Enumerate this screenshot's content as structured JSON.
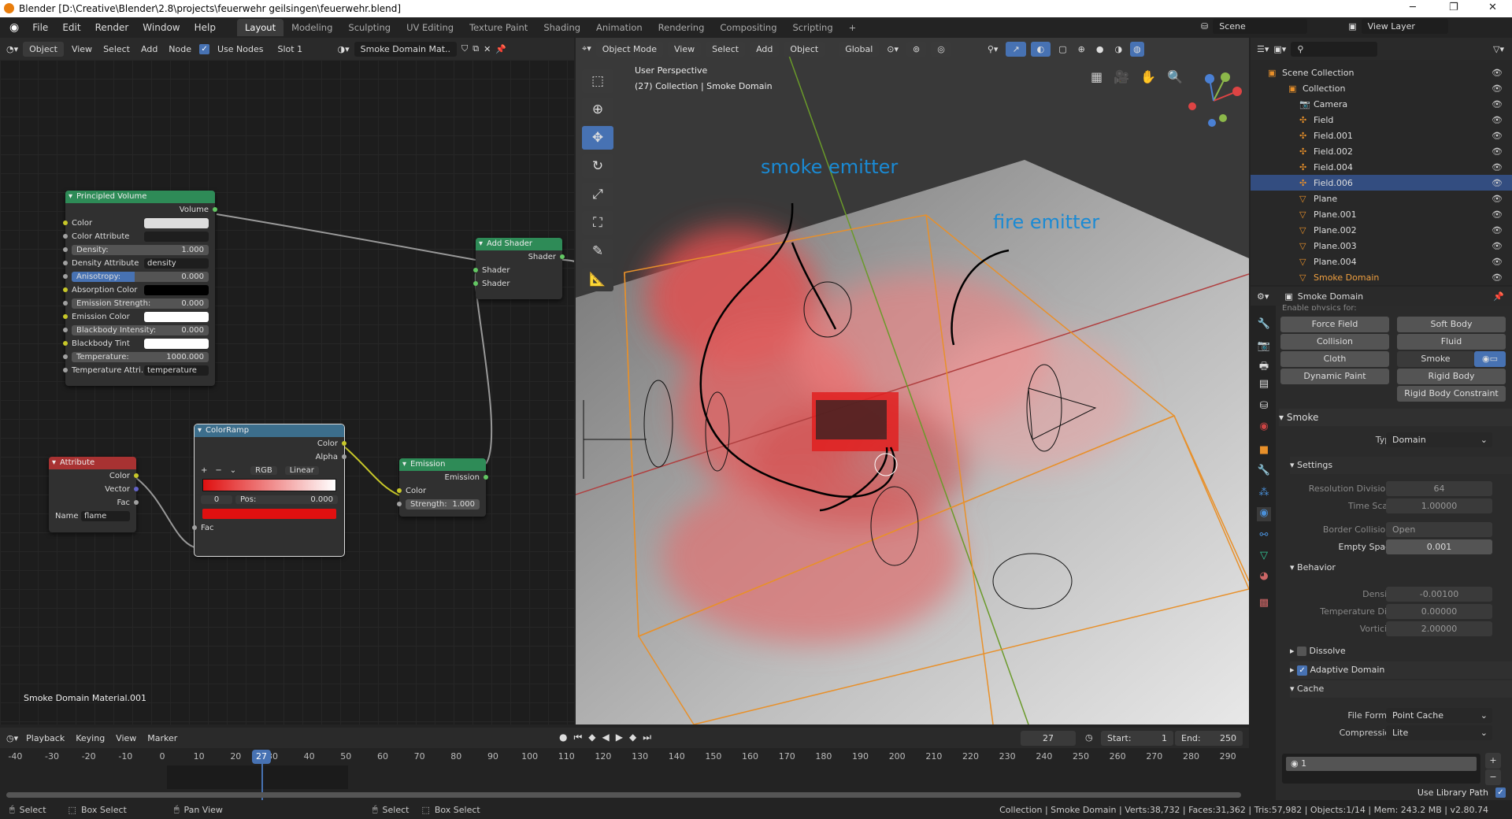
{
  "title": "Blender [D:\\Creative\\Blender\\2.8\\projects\\feuerwehr geilsingen\\feuerwehr.blend]",
  "menu": [
    "File",
    "Edit",
    "Render",
    "Window",
    "Help"
  ],
  "workspaces": [
    "Layout",
    "Modeling",
    "Sculpting",
    "UV Editing",
    "Texture Paint",
    "Shading",
    "Animation",
    "Rendering",
    "Compositing",
    "Scripting",
    "+"
  ],
  "active_workspace": "Layout",
  "scene": "Scene",
  "view_layer": "View Layer",
  "node_header": {
    "mode": "Object",
    "view": "View",
    "select": "Select",
    "add": "Add",
    "node": "Node",
    "use_nodes": "Use Nodes",
    "slot": "Slot 1",
    "material": "Smoke Domain Mat.."
  },
  "node_editor_label": "Smoke Domain Material.001",
  "nodes": {
    "principled": {
      "title": "Principled Volume",
      "output": "Volume",
      "color": "Color",
      "color_attr": "Color Attribute",
      "density_l": "Density:",
      "density_v": "1.000",
      "density_attr": "Density Attribute",
      "density_attr_v": "density",
      "aniso_l": "Anisotropy:",
      "aniso_v": "0.000",
      "absorption": "Absorption Color",
      "em_str_l": "Emission Strength:",
      "em_str_v": "0.000",
      "em_color": "Emission Color",
      "bb_int_l": "Blackbody Intensity:",
      "bb_int_v": "0.000",
      "bb_tint": "Blackbody Tint",
      "temp_l": "Temperature:",
      "temp_v": "1000.000",
      "temp_attr": "Temperature Attri..",
      "temp_attr_v": "temperature"
    },
    "add_shader": {
      "title": "Add Shader",
      "out": "Shader",
      "in1": "Shader",
      "in2": "Shader"
    },
    "colorramp": {
      "title": "ColorRamp",
      "color": "Color",
      "alpha": "Alpha",
      "mode": "RGB",
      "interp": "Linear",
      "index": "0",
      "pos_l": "Pos:",
      "pos_v": "0.000",
      "fac": "Fac",
      "stop_color": "#e01010"
    },
    "attribute": {
      "title": "Attribute",
      "color": "Color",
      "vector": "Vector",
      "fac": "Fac",
      "name_l": "Name",
      "name_v": "flame"
    },
    "emission": {
      "title": "Emission",
      "out": "Emission",
      "color": "Color",
      "str_l": "Strength:",
      "str_v": "1.000"
    }
  },
  "viewport_header": {
    "mode": "Object Mode",
    "view": "View",
    "select": "Select",
    "add": "Add",
    "object": "Object",
    "orientation": "Global"
  },
  "viewport": {
    "perspective": "User Perspective",
    "info": "(27) Collection | Smoke Domain",
    "label_smoke": "smoke emitter",
    "label_fire": "fire emitter"
  },
  "outliner": {
    "root": "Scene Collection",
    "items": [
      {
        "name": "Collection",
        "type": "collection"
      },
      {
        "name": "Camera",
        "type": "camera"
      },
      {
        "name": "Field",
        "type": "empty"
      },
      {
        "name": "Field.001",
        "type": "empty"
      },
      {
        "name": "Field.002",
        "type": "empty"
      },
      {
        "name": "Field.004",
        "type": "empty"
      },
      {
        "name": "Field.006",
        "type": "empty",
        "selected": true
      },
      {
        "name": "Plane",
        "type": "mesh"
      },
      {
        "name": "Plane.001",
        "type": "mesh"
      },
      {
        "name": "Plane.002",
        "type": "mesh"
      },
      {
        "name": "Plane.003",
        "type": "mesh"
      },
      {
        "name": "Plane.004",
        "type": "mesh"
      },
      {
        "name": "Smoke Domain",
        "type": "mesh",
        "active": true
      }
    ]
  },
  "properties": {
    "object": "Smoke Domain",
    "enable_physics": "Enable physics for:",
    "physics": [
      "Force Field",
      "Soft Body",
      "Collision",
      "Fluid",
      "Cloth",
      "Smoke",
      "Dynamic Paint",
      "Rigid Body",
      "Rigid Body Constraint"
    ],
    "smoke": "Smoke",
    "type_l": "Type",
    "type_v": "Domain",
    "settings": "Settings",
    "res_l": "Resolution Divisions",
    "res_v": "64",
    "ts_l": "Time Scale",
    "ts_v": "1.00000",
    "bc_l": "Border Collisions",
    "bc_v": "Open",
    "es_l": "Empty Space",
    "es_v": "0.001",
    "behavior": "Behavior",
    "den_l": "Density",
    "den_v": "-0.00100",
    "td_l": "Temperature Diff.",
    "td_v": "0.00000",
    "vor_l": "Vorticity",
    "vor_v": "2.00000",
    "dissolve": "Dissolve",
    "adaptive": "Adaptive Domain",
    "cache": "Cache",
    "ff_l": "File Format",
    "ff_v": "Point Cache",
    "comp_l": "Compression",
    "comp_v": "Lite",
    "cache_item": "1",
    "lib_path": "Use Library Path"
  },
  "timeline": {
    "playback": "Playback",
    "keying": "Keying",
    "view": "View",
    "marker": "Marker",
    "current": "27",
    "start_l": "Start:",
    "start": "1",
    "end_l": "End:",
    "end": "250",
    "ticks": [
      -40,
      -30,
      -20,
      -10,
      0,
      10,
      20,
      30,
      40,
      50,
      60,
      70,
      80,
      90,
      100,
      110,
      120,
      130,
      140,
      150,
      160,
      170,
      180,
      190,
      200,
      210,
      220,
      230,
      240,
      250,
      260,
      270,
      280,
      290
    ]
  },
  "status": {
    "select": "Select",
    "box_select": "Box Select",
    "pan": "Pan View",
    "select2": "Select",
    "box_select2": "Box Select",
    "info": "Collection | Smoke Domain | Verts:38,732 | Faces:31,362 | Tris:57,982 | Objects:1/14 | Mem: 243.2 MB | v2.80.74"
  }
}
